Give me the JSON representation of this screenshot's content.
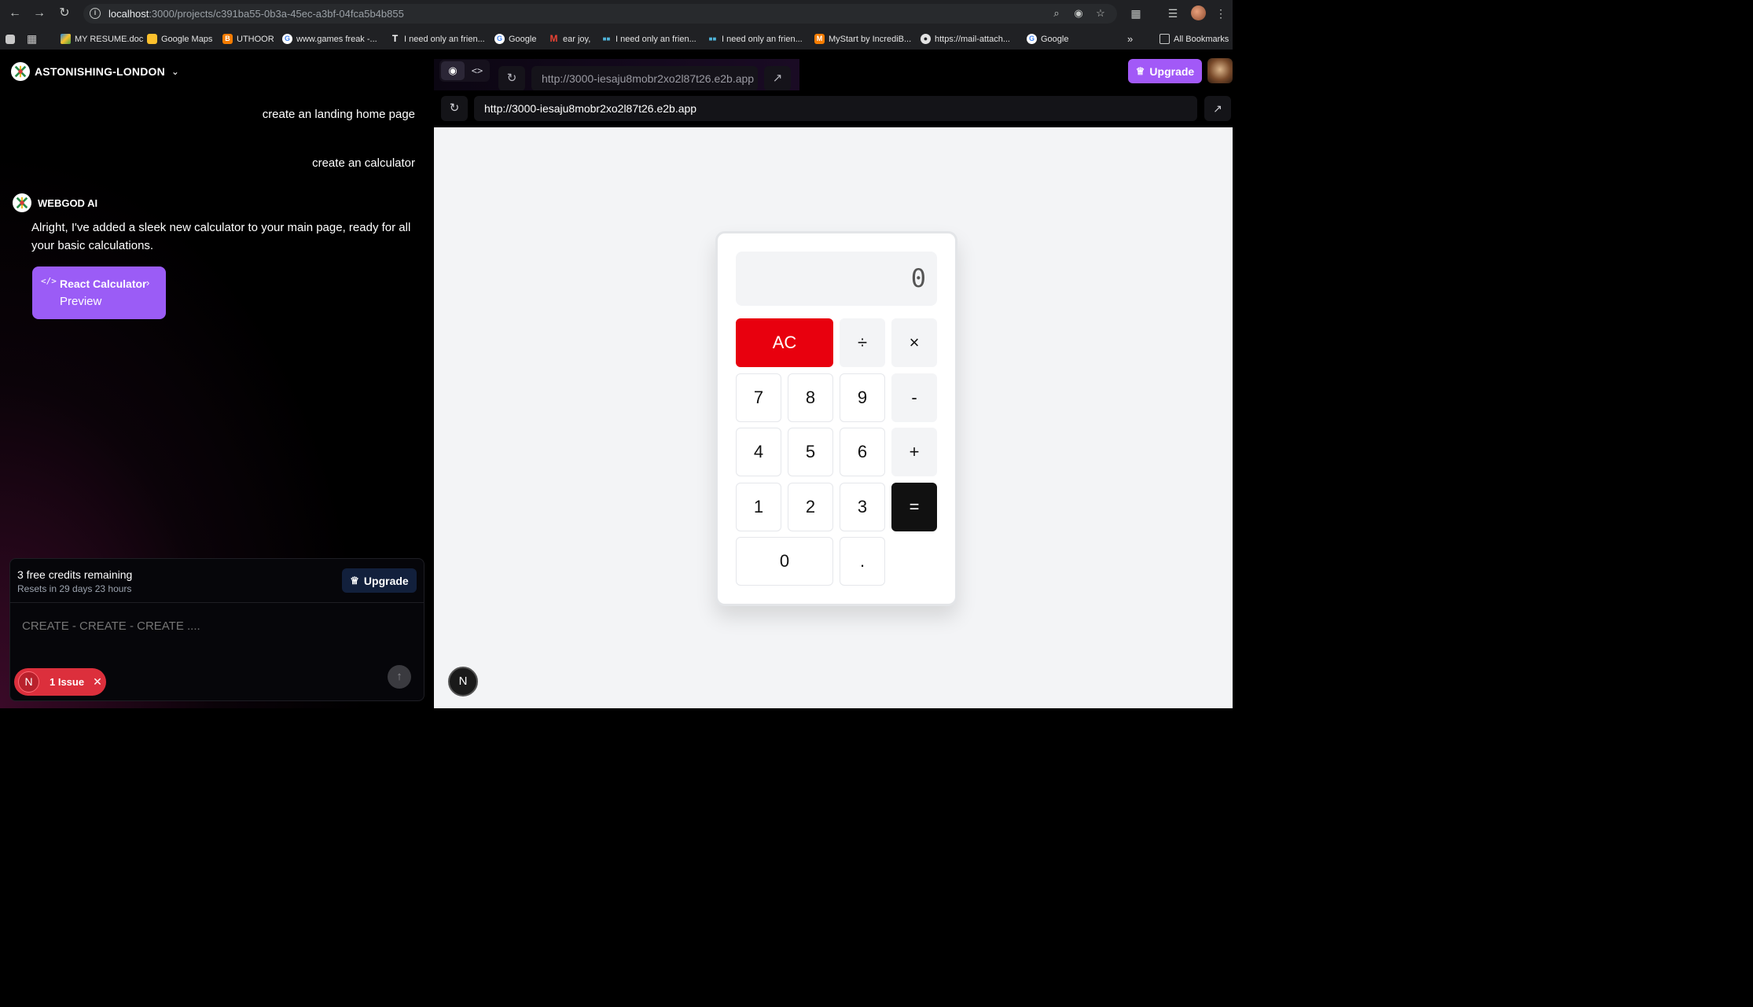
{
  "browser": {
    "url_host": "localhost",
    "url_path": ":3000/projects/c391ba55-0b3a-45ec-a3bf-04fca5b4b855",
    "bookmarks": [
      "MY RESUME.doc",
      "Google Maps",
      "UTHOOR",
      "www.games freak -...",
      "I need only an frien...",
      "Google",
      "ear joy,",
      "I need only an frien...",
      "I need only an frien...",
      "MyStart by IncrediB...",
      "https://mail-attach...",
      "Google"
    ],
    "more_label": "»",
    "all_bookmarks": "All Bookmarks"
  },
  "sidebar": {
    "project_name": "ASTONISHING-LONDON",
    "user_messages": [
      "create an landing home page",
      "create an calculator"
    ],
    "ai_name": "WEBGOD AI",
    "ai_message": "Alright, I've added a sleek new calculator to your main page, ready for all your basic calculations.",
    "card": {
      "title": "React Calculator",
      "subtitle": "Preview"
    },
    "credits": {
      "title": "3 free credits remaining",
      "reset": "Resets in 29 days 23 hours"
    },
    "upgrade_label": "Upgrade",
    "prompt_placeholder": "CREATE - CREATE - CREATE ....",
    "issue": {
      "letter": "N",
      "text": "1 Issue"
    }
  },
  "header": {
    "url": "http://3000-iesaju8mobr2xo2l87t26.e2b.app",
    "upgrade_label": "Upgrade"
  },
  "preview": {
    "url": "http://3000-iesaju8mobr2xo2l87t26.e2b.app",
    "calculator": {
      "display": "0",
      "keys": {
        "ac": "AC",
        "divide": "÷",
        "multiply": "×",
        "minus": "-",
        "plus": "+",
        "equals": "=",
        "k7": "7",
        "k8": "8",
        "k9": "9",
        "k4": "4",
        "k5": "5",
        "k6": "6",
        "k1": "1",
        "k2": "2",
        "k3": "3",
        "k0": "0",
        "dot": "."
      }
    },
    "next_badge": "N"
  },
  "colors": {
    "accent_purple": "#a259f7",
    "card_purple": "#9b5cf6",
    "ac_red": "#e8000e",
    "issue_red": "#dc2f3c"
  }
}
